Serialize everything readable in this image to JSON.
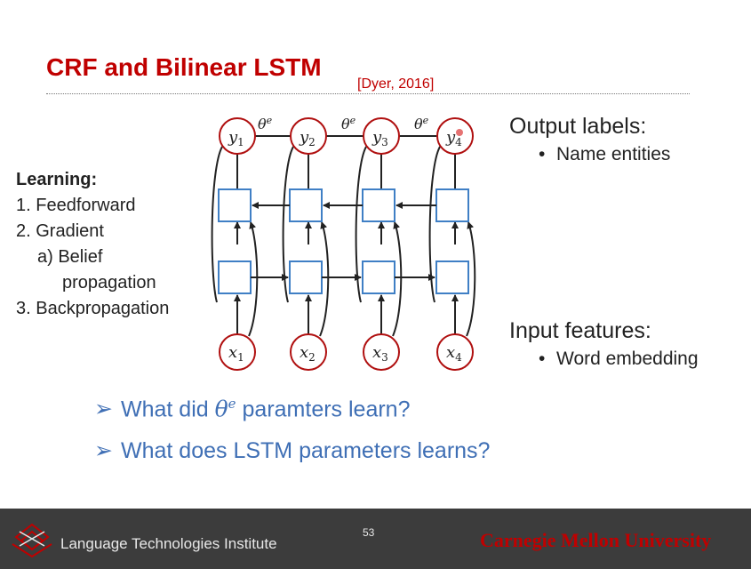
{
  "slide": {
    "title": "CRF and Bilinear LSTM",
    "citation": "[Dyer, 2016]",
    "learning": {
      "heading": "Learning:",
      "items": [
        "1. Feedforward",
        "2. Gradient",
        "a) Belief",
        "propagation",
        "3.  Backpropagation"
      ]
    },
    "output": {
      "title": "Output labels:",
      "bullet": "Name entities"
    },
    "input": {
      "title": "Input features:",
      "bullet": "Word embedding"
    },
    "questions": {
      "q1_pre": "What did ",
      "q1_sym": "θ",
      "q1_sup": "e",
      "q1_post": " paramters learn?",
      "q2": "What does LSTM parameters learns?"
    },
    "diagram": {
      "output_nodes": [
        {
          "base": "y",
          "sub": "1"
        },
        {
          "base": "y",
          "sub": "2"
        },
        {
          "base": "y",
          "sub": "3"
        },
        {
          "base": "y",
          "sub": "4"
        }
      ],
      "input_nodes": [
        {
          "base": "x",
          "sub": "1"
        },
        {
          "base": "x",
          "sub": "2"
        },
        {
          "base": "x",
          "sub": "3"
        },
        {
          "base": "x",
          "sub": "4"
        }
      ],
      "edge_label_base": "θ",
      "edge_label_sup": "e"
    },
    "page_number": "53"
  },
  "footer": {
    "institute": "Language Technologies Institute",
    "university": "Carnegie Mellon University"
  },
  "colors": {
    "title_red": "#c00000",
    "question_blue": "#3f6fb5",
    "node_blue": "#3f7fc5",
    "node_red": "#b01010",
    "footer_bg": "#3c3c3c"
  },
  "icons": [
    "arrow-bullet-icon",
    "lti-logo-icon"
  ]
}
